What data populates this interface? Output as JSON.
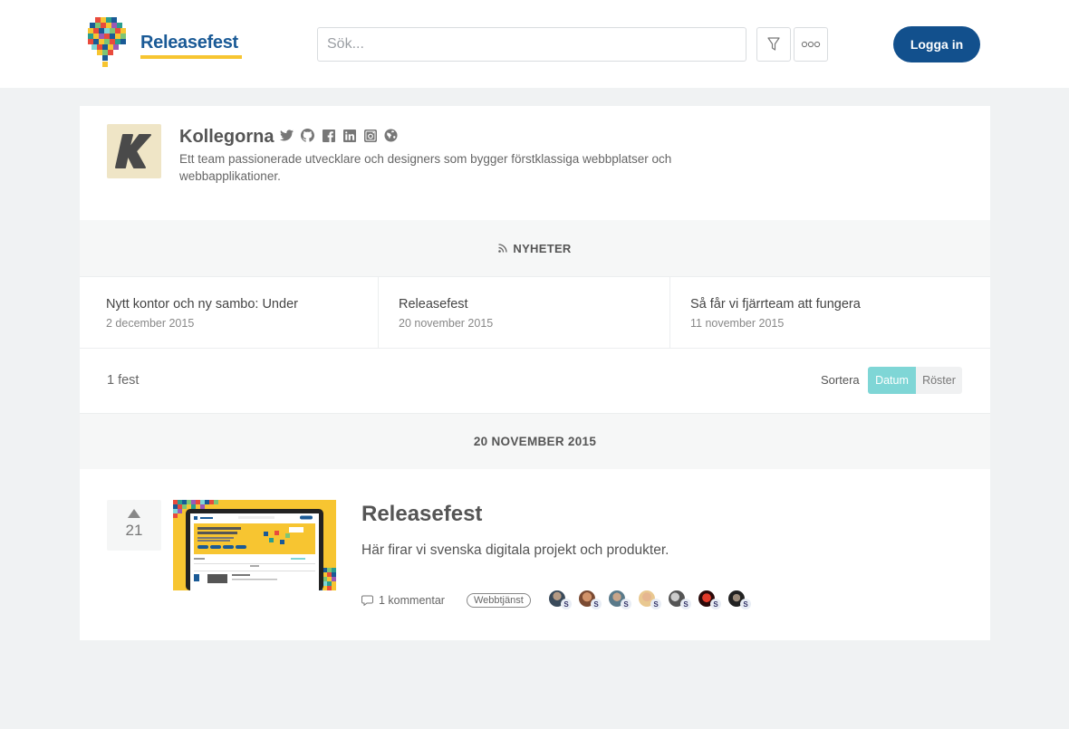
{
  "header": {
    "brand": "Releasefest",
    "search_placeholder": "Sök...",
    "login_label": "Logga in",
    "brand_color": "#1a5a96",
    "accent_color": "#f7c531"
  },
  "organization": {
    "avatar_letter": "K",
    "name": "Kollegorna",
    "social_icons": [
      "twitter-icon",
      "github-icon",
      "facebook-icon",
      "linkedin-icon",
      "instagram-icon",
      "globe-icon"
    ],
    "description": "Ett team passionerade utvecklare och designers som bygger förstklassiga webbplatser och webbapplikationer."
  },
  "news": {
    "heading": "NYHETER",
    "items": [
      {
        "title": "Nytt kontor och ny sambo: Under",
        "date": "2 december 2015"
      },
      {
        "title": "Releasefest",
        "date": "20 november 2015"
      },
      {
        "title": "Så får vi fjärrteam att fungera",
        "date": "11 november 2015"
      }
    ]
  },
  "listing": {
    "count": "1 fest",
    "sort_label": "Sortera",
    "sort_options": [
      "Datum",
      "Röster"
    ],
    "sort_selected": "Datum",
    "date_heading": "20 NOVEMBER 2015"
  },
  "post": {
    "votes": "21",
    "title": "Releasefest",
    "description": "Här firar vi svenska digitala projekt och produkter.",
    "comments": "1 kommentar",
    "tag": "Webbtjänst",
    "voter_badge": "S",
    "voter_count": 7
  }
}
